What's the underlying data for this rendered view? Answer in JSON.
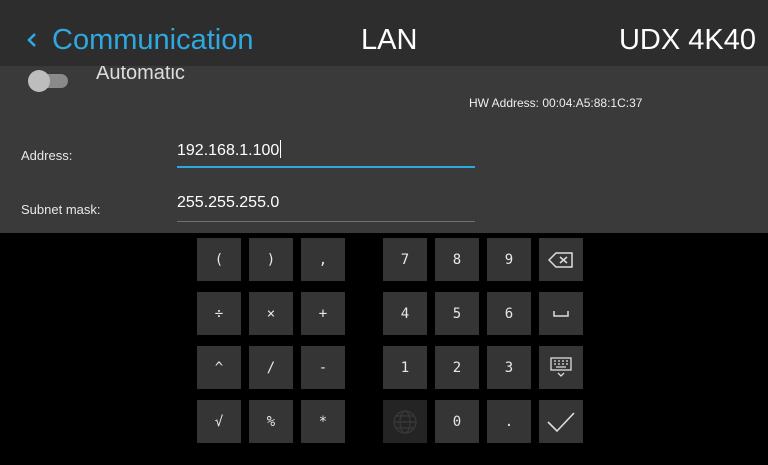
{
  "header": {
    "back_label": "Communication",
    "section": "LAN",
    "device": "UDX 4K40",
    "accent": "#2fa8e0"
  },
  "panel": {
    "toggle_label": "Automatic",
    "hw_address": "HW Address: 00:04:A5:88:1C:37",
    "fields": [
      {
        "label": "Address:",
        "value": "192.168.1.100"
      },
      {
        "label": "Subnet mask:",
        "value": "255.255.255.0"
      }
    ]
  },
  "keypad": {
    "left": [
      [
        "(",
        ")",
        ","
      ],
      [
        "÷",
        "×",
        "+"
      ],
      [
        "^",
        "/",
        "-"
      ],
      [
        "√",
        "%",
        "*"
      ]
    ],
    "mid": [
      [
        "7",
        "8",
        "9"
      ],
      [
        "4",
        "5",
        "6"
      ],
      [
        "1",
        "2",
        "3"
      ],
      [
        "globe-icon",
        "0",
        "."
      ]
    ],
    "right": [
      "backspace-icon",
      "space-icon",
      "keyboard-icon",
      "check-icon"
    ]
  }
}
